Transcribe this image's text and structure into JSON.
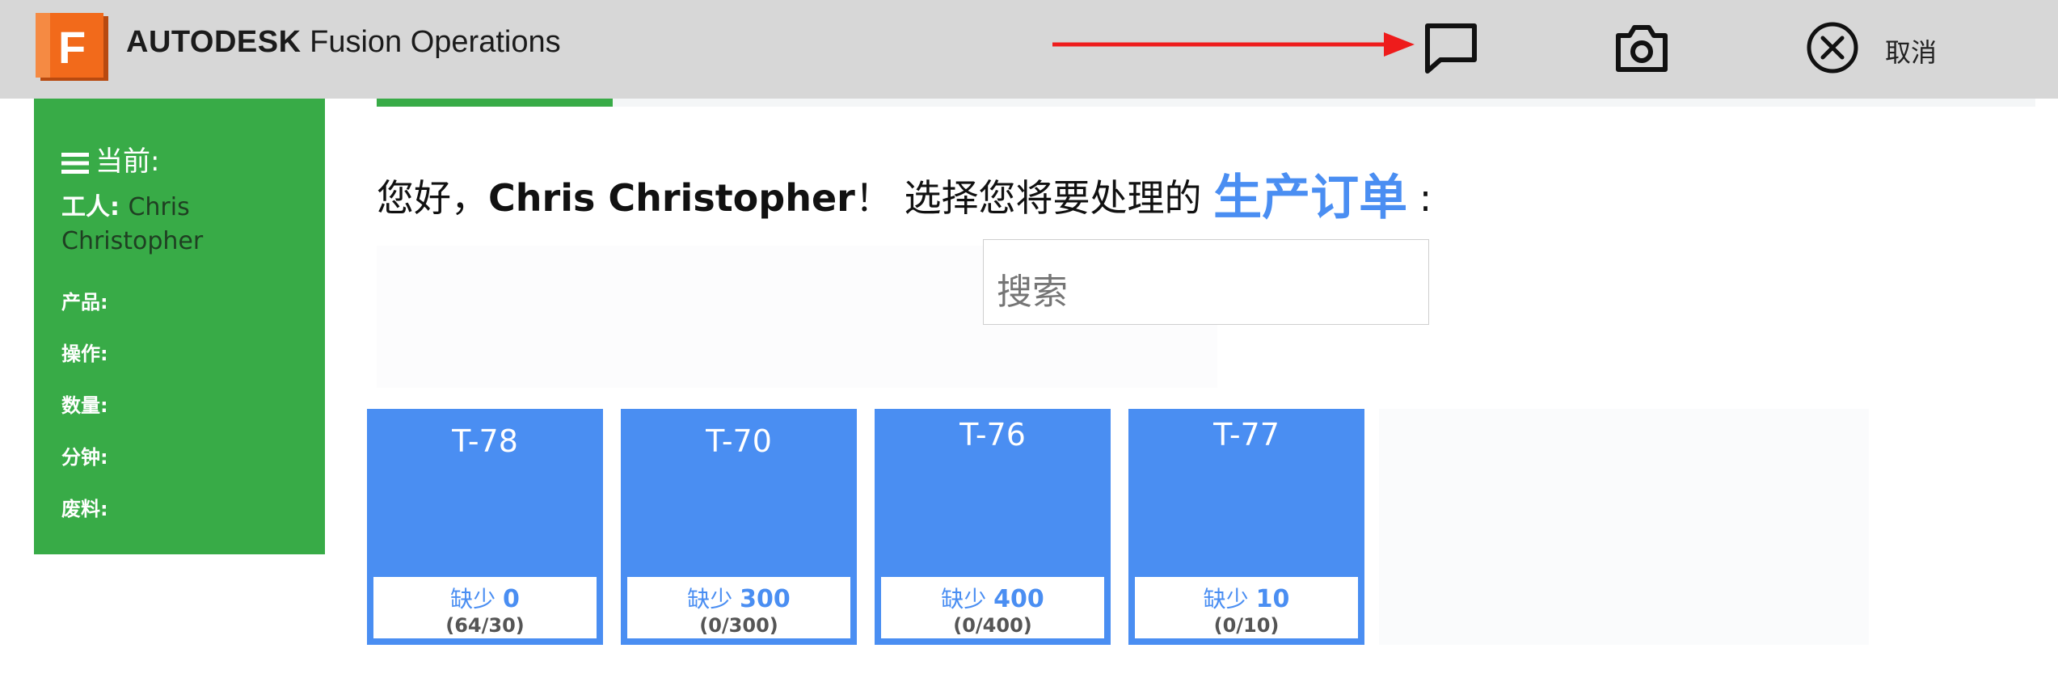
{
  "header": {
    "brand_main": "AUTODESK",
    "brand_sub": " Fusion Operations",
    "logo_letter": "F",
    "cancel_label": "取消",
    "colors": {
      "bar": "#d7d7d7",
      "logo": "#f26a1b",
      "arrow": "#ee1c1c"
    },
    "icons": [
      "message-icon",
      "camera-icon",
      "close-circle-icon"
    ]
  },
  "sidebar": {
    "current_label": "当前:",
    "worker_label": "工人",
    "worker_value": "Chris Christopher",
    "fields": [
      "产品:",
      "操作:",
      "数量:",
      "分钟:",
      "废料:"
    ],
    "color": "#38ab47"
  },
  "main": {
    "greeting_prefix": "您好，",
    "greeting_name": "Chris Christopher",
    "greeting_middle": "！ 选择您将要处理的 ",
    "greeting_order": "生产订单",
    "greeting_suffix": " :",
    "search_placeholder": "搜索",
    "tiles": [
      {
        "title": "T-78",
        "short_label": "缺少",
        "short_value": "0",
        "count": "(64/30)"
      },
      {
        "title": "T-70",
        "short_label": "缺少",
        "short_value": "300",
        "count": "(0/300)"
      },
      {
        "title": "T-76",
        "short_label": "缺少",
        "short_value": "400",
        "count": "(0/400)"
      },
      {
        "title": "T-77",
        "short_label": "缺少",
        "short_value": "10",
        "count": "(0/10)"
      }
    ],
    "tile_color": "#4a8ef2"
  }
}
